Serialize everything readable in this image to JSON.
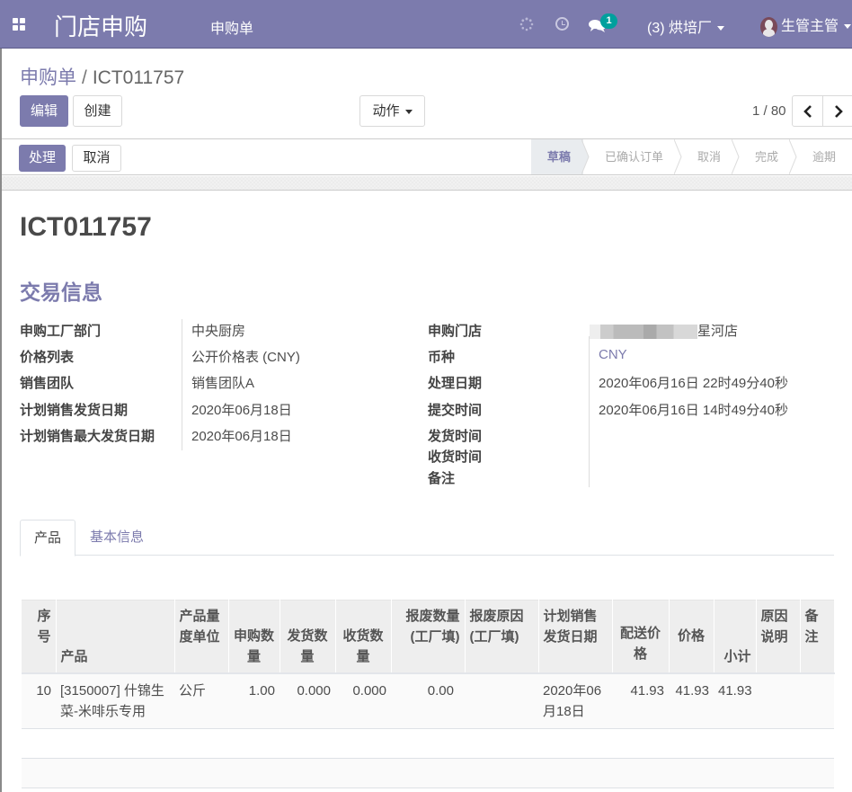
{
  "navbar": {
    "app_name": "门店申购",
    "menu_item": "申购单",
    "chat_badge": "1",
    "company": "(3)  烘培厂",
    "user": "生管主管"
  },
  "breadcrumb": {
    "parent": "申购单",
    "separator": "/",
    "current": "ICT011757"
  },
  "toolbar": {
    "edit_label": "编辑",
    "create_label": "创建",
    "action_label": "动作",
    "pager_value": "1 / 80"
  },
  "statusbar": {
    "process_label": "处理",
    "cancel_label": "取消",
    "stages": [
      {
        "label": "草稿",
        "active": true
      },
      {
        "label": "已确认订单",
        "active": false
      },
      {
        "label": "取消",
        "active": false
      },
      {
        "label": "完成",
        "active": false
      },
      {
        "label": "逾期",
        "active": false
      }
    ]
  },
  "record": {
    "name": "ICT011757",
    "section_title": "交易信息",
    "left_fields": [
      {
        "label": "申购工厂部门",
        "value": "中央厨房"
      },
      {
        "label": "价格列表",
        "value": "公开价格表 (CNY)"
      },
      {
        "label": "销售团队",
        "value": "销售团队A"
      },
      {
        "label": "计划销售发货日期",
        "value": "2020年06月18日"
      },
      {
        "label": "计划销售最大发货日期",
        "value": "2020年06月18日"
      }
    ],
    "right_fields": [
      {
        "label": "申购门店",
        "value": "星河店"
      },
      {
        "label": "币种",
        "value": "CNY"
      },
      {
        "label": "处理日期",
        "value": "2020年06月16日 22时49分40秒"
      },
      {
        "label": "提交时间",
        "value": "2020年06月16日 14时49分40秒"
      },
      {
        "label": "发货时间",
        "value": ""
      },
      {
        "label": "收货时间",
        "value": ""
      },
      {
        "label": "备注",
        "value": ""
      }
    ]
  },
  "tabs": [
    {
      "label": "产品",
      "active": true
    },
    {
      "label": "基本信息",
      "active": false
    }
  ],
  "table": {
    "headers": [
      "序号",
      "产品",
      "产品量度单位",
      "申购数量",
      "发货数量",
      "收货数量",
      "报废数量(工厂填)",
      "报废原因(工厂填)",
      "计划销售发货日期",
      "配送价格",
      "价格",
      "小计",
      "原因说明",
      "备注"
    ],
    "rows": [
      {
        "seq": "10",
        "product": "[3150007] 什锦生菜-米啡乐专用",
        "uom": "公斤",
        "req_qty": "1.00",
        "ship_qty": "0.000",
        "recv_qty": "0.000",
        "scrap_qty": "0.00",
        "scrap_reason": "",
        "plan_date": "2020年06月18日",
        "delivery_price": "41.93",
        "price": "41.93",
        "subtotal": "41.93",
        "reason_note": "",
        "remark": ""
      }
    ]
  }
}
